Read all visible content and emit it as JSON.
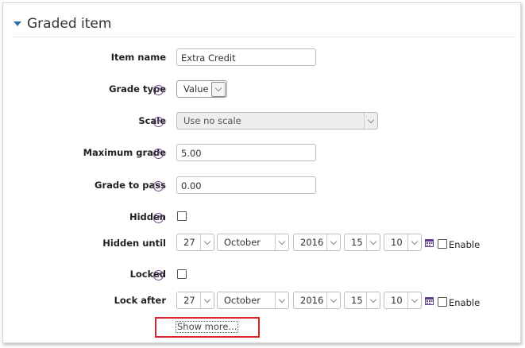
{
  "section": {
    "title": "Graded item"
  },
  "fields": {
    "item_name": {
      "label": "Item name",
      "value": "Extra Credit"
    },
    "grade_type": {
      "label": "Grade type",
      "value": "Value"
    },
    "scale": {
      "label": "Scale",
      "value": "Use no scale"
    },
    "maximum_grade": {
      "label": "Maximum grade",
      "value": "5.00"
    },
    "grade_to_pass": {
      "label": "Grade to pass",
      "value": "0.00"
    },
    "hidden": {
      "label": "Hidden"
    },
    "hidden_until": {
      "label": "Hidden until",
      "day": "27",
      "month": "October",
      "year": "2016",
      "hour": "15",
      "minute": "10",
      "enable_label": "Enable"
    },
    "locked": {
      "label": "Locked"
    },
    "lock_after": {
      "label": "Lock after",
      "day": "27",
      "month": "October",
      "year": "2016",
      "hour": "15",
      "minute": "10",
      "enable_label": "Enable"
    }
  },
  "help_glyph": "?",
  "show_more": "Show more...",
  "colors": {
    "accent": "#2f6fa3",
    "help": "#6c4a8e",
    "highlight": "#d8252b",
    "calendar": "#5b3c88"
  },
  "icons": {
    "collapse": "caret-down-icon",
    "help": "question-circle-icon",
    "calendar": "calendar-icon"
  }
}
